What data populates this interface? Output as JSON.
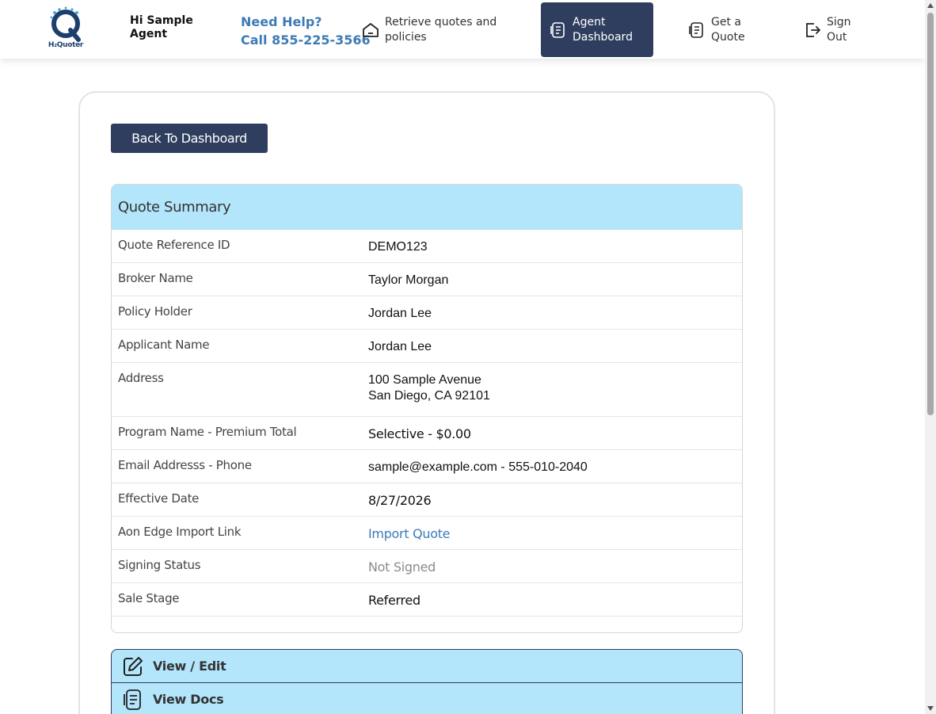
{
  "brand": {
    "logo_text": "H₂Quoter"
  },
  "header": {
    "greeting": "Hi Sample Agent",
    "help_line1": "Need Help?",
    "help_line2": "Call 855-225-3566",
    "nav": [
      {
        "label_line1": "Retrieve quotes and",
        "label_line2": "policies",
        "icon": "home-icon"
      },
      {
        "label_line1": "Agent",
        "label_line2": "Dashboard",
        "icon": "document-icon",
        "active": true
      },
      {
        "label_line1": "Get a",
        "label_line2": "Quote",
        "icon": "document-icon"
      },
      {
        "label_line1": "Sign",
        "label_line2": "Out",
        "icon": "sign-out-icon"
      }
    ]
  },
  "back_button": {
    "label": "Back To Dashboard"
  },
  "summary": {
    "title": "Quote Summary",
    "rows": [
      {
        "label": "Quote Reference ID",
        "value": "DEMO123"
      },
      {
        "label": "Broker Name",
        "value": "Taylor Morgan"
      },
      {
        "label": "Policy Holder",
        "value": "Jordan Lee"
      },
      {
        "label": "Applicant Name",
        "value": "Jordan Lee"
      },
      {
        "label": "Address",
        "value_line1": "100 Sample Avenue",
        "value_line2": "San Diego, CA 92101"
      },
      {
        "label": "Program Name - Premium Total",
        "value": "Selective - $0.00"
      },
      {
        "label": "Email Addresss - Phone",
        "value": "sample@example.com - 555-010-2040"
      },
      {
        "label": "Effective Date",
        "value": "8/27/2026"
      },
      {
        "label": "Aon Edge Import Link",
        "value": "Import Quote"
      },
      {
        "label": "Signing Status",
        "value": "Not Signed"
      },
      {
        "label": "Sale Stage",
        "value": "Referred"
      }
    ]
  },
  "actions": {
    "edit_label": "View / Edit",
    "docs_label": "View Docs"
  },
  "colors": {
    "primary": "#2f3e5f",
    "accent_light": "#b3e5fb",
    "link": "#3d7bb5"
  }
}
